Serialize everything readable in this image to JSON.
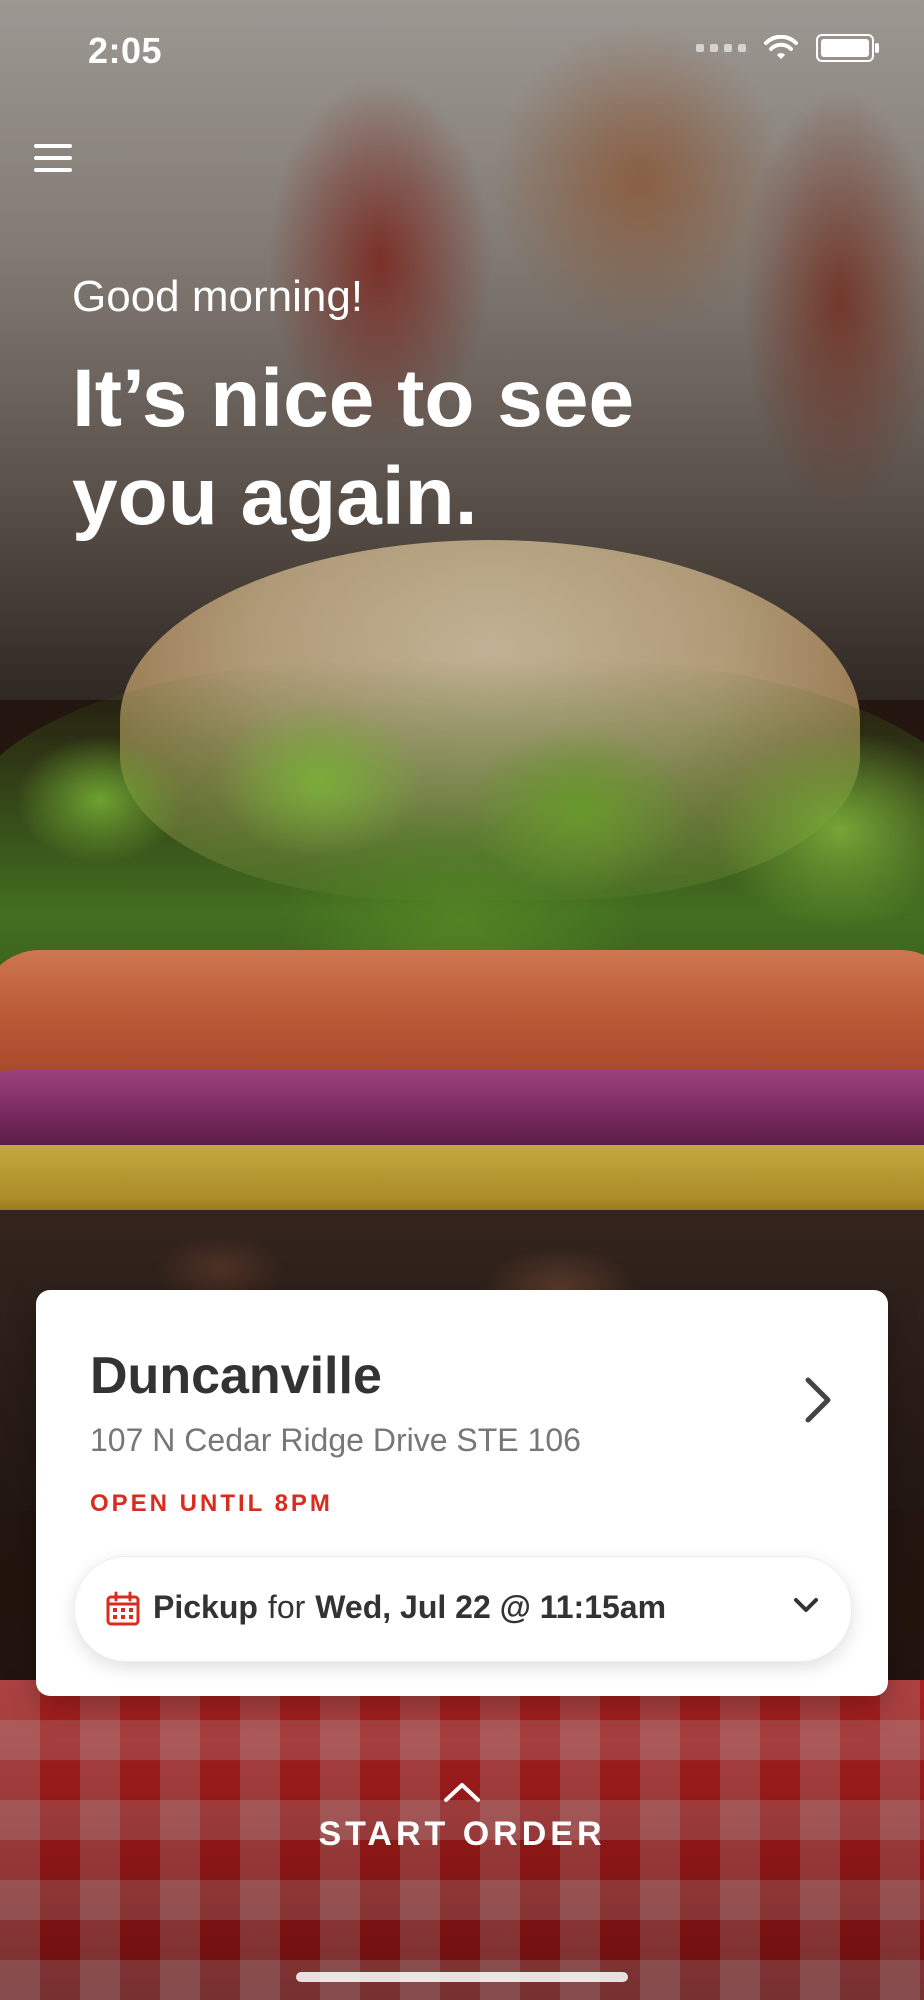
{
  "status_bar": {
    "time": "2:05"
  },
  "greeting": {
    "subtitle": "Good morning!",
    "headline": "It’s nice to see you again."
  },
  "location": {
    "name": "Duncanville",
    "address": "107 N Cedar Ridge Drive STE 106",
    "hours": "OPEN UNTIL 8PM"
  },
  "order_mode": {
    "mode_label": "Pickup",
    "connector": "for",
    "datetime": "Wed, Jul 22 @ 11:15am"
  },
  "cta": {
    "label": "START ORDER"
  },
  "icons": {
    "menu": "hamburger-menu-icon",
    "location_chevron": "chevron-right-icon",
    "calendar": "calendar-icon",
    "dropdown_chevron": "chevron-down-icon",
    "start_chevron": "chevron-up-icon",
    "wifi": "wifi-icon",
    "battery": "battery-icon",
    "signal": "cellular-signal-icon"
  },
  "colors": {
    "accent_red": "#d92c1f",
    "card_bg": "#ffffff",
    "text_dark": "#333333",
    "text_muted": "#777777"
  }
}
